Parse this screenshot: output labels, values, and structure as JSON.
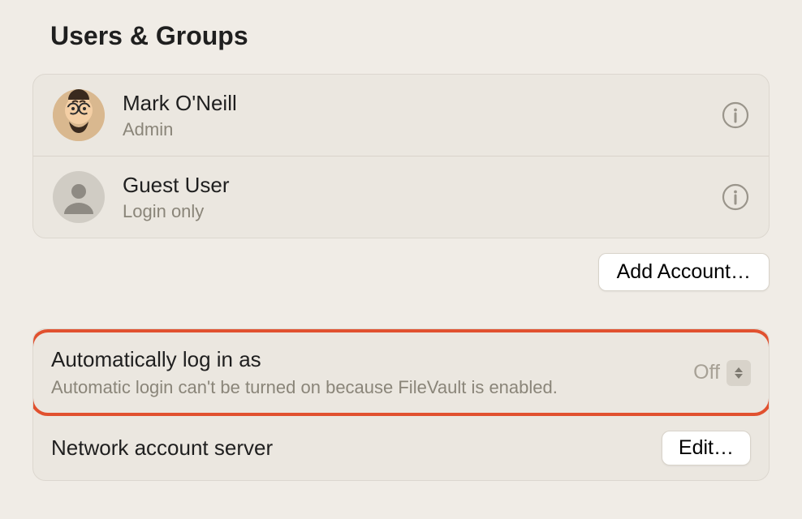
{
  "page_title": "Users & Groups",
  "users": [
    {
      "name": "Mark O'Neill",
      "role": "Admin",
      "avatar": "mark"
    },
    {
      "name": "Guest User",
      "role": "Login only",
      "avatar": "guest"
    }
  ],
  "buttons": {
    "add_account": "Add Account…",
    "edit": "Edit…"
  },
  "settings": {
    "auto_login": {
      "label": "Automatically log in as",
      "subtext": "Automatic login can't be turned on because FileVault is enabled.",
      "value": "Off"
    },
    "network_server": {
      "label": "Network account server"
    }
  }
}
